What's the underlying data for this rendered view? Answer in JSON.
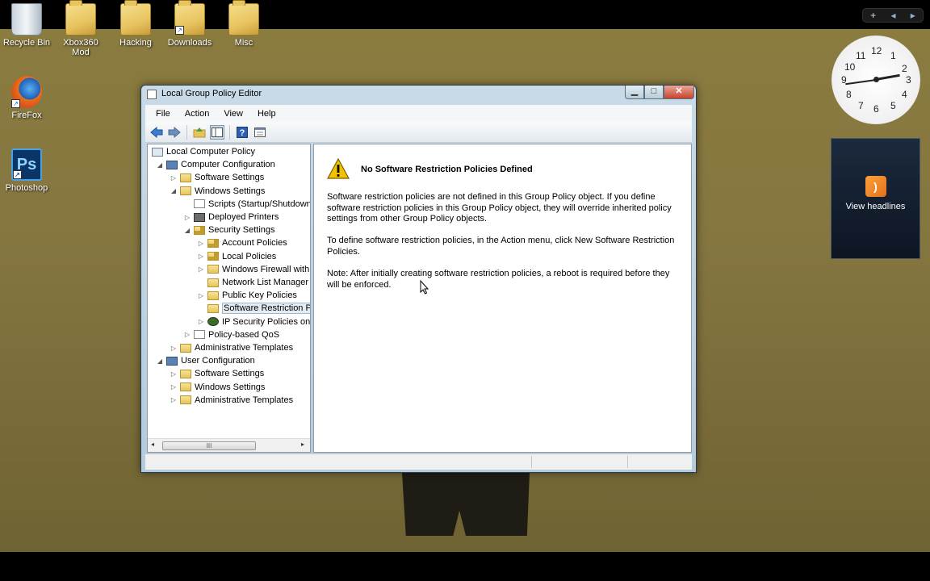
{
  "desktop": {
    "icons": [
      {
        "label": "Recycle Bin",
        "icon": "recycle-bin-icon"
      },
      {
        "label": "Xbox360 Mod",
        "icon": "folder-icon"
      },
      {
        "label": "Hacking",
        "icon": "folder-icon"
      },
      {
        "label": "Downloads",
        "icon": "folder-shortcut-icon"
      },
      {
        "label": "Misc",
        "icon": "folder-icon"
      },
      {
        "label": "FireFox",
        "icon": "firefox-icon"
      },
      {
        "label": "Photoshop",
        "icon": "photoshop-icon",
        "glyph": "Ps"
      }
    ],
    "gadget_controls": {
      "add": "+",
      "prev": "◂",
      "next": "▸"
    },
    "clock": {
      "numbers": [
        "12",
        "1",
        "2",
        "3",
        "4",
        "5",
        "6",
        "7",
        "8",
        "9",
        "10",
        "11"
      ]
    },
    "headlines": {
      "label": "View headlines"
    }
  },
  "window": {
    "title": "Local Group Policy Editor",
    "controls": {
      "minimize": "▁",
      "maximize": "□",
      "close": "✕"
    },
    "menu": [
      "File",
      "Action",
      "View",
      "Help"
    ],
    "toolbar": [
      "back-icon",
      "forward-icon",
      "up-folder-icon",
      "show-hide-tree-icon",
      "help-icon",
      "properties-icon"
    ],
    "tree": [
      {
        "label": "Local Computer Policy",
        "indent": 0,
        "expander": "",
        "icon": "policy"
      },
      {
        "label": "Computer Configuration",
        "indent": 1,
        "expander": "◢",
        "icon": "pc"
      },
      {
        "label": "Software Settings",
        "indent": 2,
        "expander": "▷",
        "icon": "folder"
      },
      {
        "label": "Windows Settings",
        "indent": 2,
        "expander": "◢",
        "icon": "folder"
      },
      {
        "label": "Scripts (Startup/Shutdown)",
        "indent": 3,
        "expander": "",
        "icon": "doc"
      },
      {
        "label": "Deployed Printers",
        "indent": 3,
        "expander": "▷",
        "icon": "printer"
      },
      {
        "label": "Security Settings",
        "indent": 3,
        "expander": "◢",
        "icon": "lock"
      },
      {
        "label": "Account Policies",
        "indent": 4,
        "expander": "▷",
        "icon": "lock"
      },
      {
        "label": "Local Policies",
        "indent": 4,
        "expander": "▷",
        "icon": "lock"
      },
      {
        "label": "Windows Firewall with Advanced Security",
        "indent": 4,
        "expander": "▷",
        "icon": "folder"
      },
      {
        "label": "Network List Manager Policies",
        "indent": 4,
        "expander": "",
        "icon": "folder"
      },
      {
        "label": "Public Key Policies",
        "indent": 4,
        "expander": "▷",
        "icon": "folder"
      },
      {
        "label": "Software Restriction Policies",
        "indent": 4,
        "expander": "",
        "icon": "folder",
        "selected": true
      },
      {
        "label": "IP Security Policies on Local Computer",
        "indent": 4,
        "expander": "▷",
        "icon": "ipsec"
      },
      {
        "label": "Policy-based QoS",
        "indent": 3,
        "expander": "▷",
        "icon": "doc"
      },
      {
        "label": "Administrative Templates",
        "indent": 2,
        "expander": "▷",
        "icon": "folder"
      },
      {
        "label": "User Configuration",
        "indent": 1,
        "expander": "◢",
        "icon": "pc"
      },
      {
        "label": "Software Settings",
        "indent": 2,
        "expander": "▷",
        "icon": "folder"
      },
      {
        "label": "Windows Settings",
        "indent": 2,
        "expander": "▷",
        "icon": "folder"
      },
      {
        "label": "Administrative Templates",
        "indent": 2,
        "expander": "▷",
        "icon": "folder"
      }
    ],
    "scrollbar": {
      "left": "◂",
      "right": "▸",
      "grip": "III"
    },
    "content": {
      "warning_icon": "warning-icon",
      "heading": "No Software Restriction Policies Defined",
      "paragraph_1": "Software restriction policies are not defined in this Group Policy object. If you define software restriction policies in this Group Policy object, they will override inherited policy settings from other Group Policy objects.",
      "paragraph_2": "To define software restriction policies, in the Action menu, click New Software Restriction Policies.",
      "paragraph_3": "Note: After initially creating software restriction policies, a reboot is required before they will be enforced."
    }
  }
}
